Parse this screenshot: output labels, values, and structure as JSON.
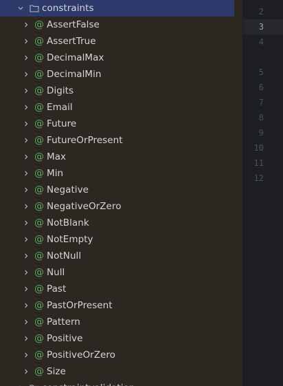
{
  "project_tree": {
    "folder": {
      "label": "constraints",
      "expanded": true,
      "selected": true
    },
    "items": [
      {
        "label": "AssertFalse",
        "icon": "annotation-icon"
      },
      {
        "label": "AssertTrue",
        "icon": "annotation-icon"
      },
      {
        "label": "DecimalMax",
        "icon": "annotation-icon"
      },
      {
        "label": "DecimalMin",
        "icon": "annotation-icon"
      },
      {
        "label": "Digits",
        "icon": "annotation-icon"
      },
      {
        "label": "Email",
        "icon": "annotation-icon"
      },
      {
        "label": "Future",
        "icon": "annotation-icon"
      },
      {
        "label": "FutureOrPresent",
        "icon": "annotation-icon"
      },
      {
        "label": "Max",
        "icon": "annotation-icon"
      },
      {
        "label": "Min",
        "icon": "annotation-icon"
      },
      {
        "label": "Negative",
        "icon": "annotation-icon"
      },
      {
        "label": "NegativeOrZero",
        "icon": "annotation-icon"
      },
      {
        "label": "NotBlank",
        "icon": "annotation-icon"
      },
      {
        "label": "NotEmpty",
        "icon": "annotation-icon"
      },
      {
        "label": "NotNull",
        "icon": "annotation-icon"
      },
      {
        "label": "Null",
        "icon": "annotation-icon"
      },
      {
        "label": "Past",
        "icon": "annotation-icon"
      },
      {
        "label": "PastOrPresent",
        "icon": "annotation-icon"
      },
      {
        "label": "Pattern",
        "icon": "annotation-icon"
      },
      {
        "label": "Positive",
        "icon": "annotation-icon"
      },
      {
        "label": "PositiveOrZero",
        "icon": "annotation-icon"
      },
      {
        "label": "Size",
        "icon": "annotation-icon"
      }
    ],
    "annotation_glyph": "@",
    "next_partial_label": "constraintvalidation"
  },
  "editor": {
    "line_numbers": [
      "2",
      "3",
      "4",
      "5",
      "6",
      "7",
      "8",
      "9",
      "10",
      "11",
      "12"
    ],
    "current_line": "3"
  },
  "colors": {
    "tree_bg": "#2c2721",
    "selection": "#2d3a6b",
    "annotation_icon": "#59a869",
    "text": "#d4d6db",
    "gutter_bg": "#1e1f22",
    "line_number": "#4b5059"
  }
}
